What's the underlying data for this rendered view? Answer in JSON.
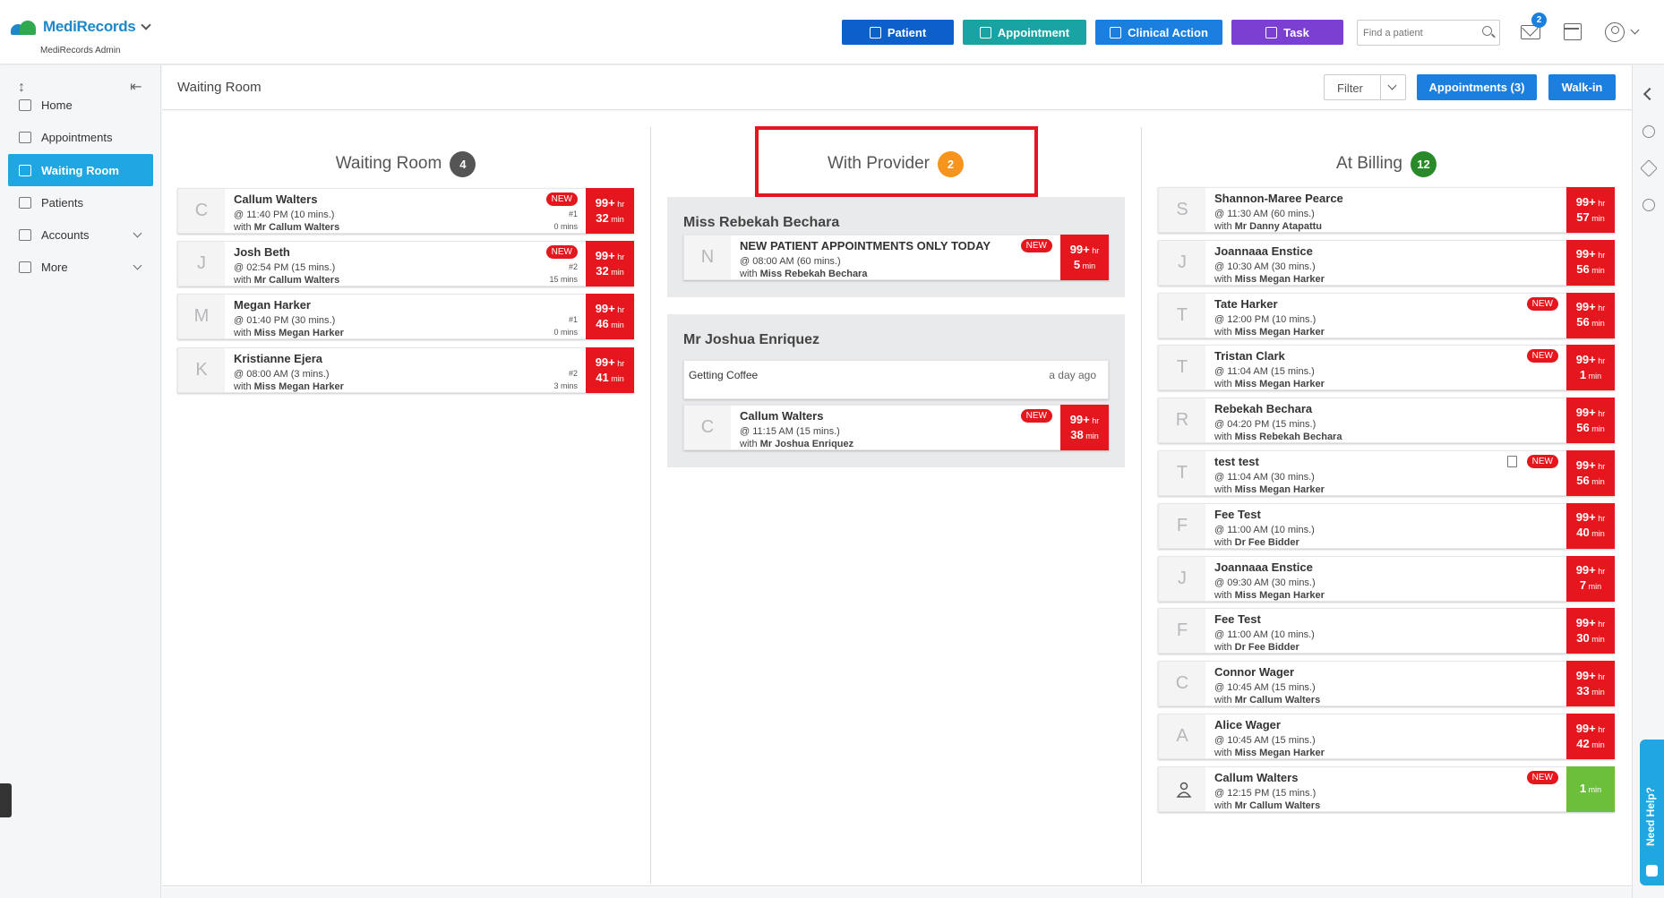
{
  "app": {
    "brand_primary": "Medi",
    "brand_secondary": "Records",
    "brand_sub": "MediRecords Admin",
    "search_placeholder": "Find a patient",
    "mail_count": "2"
  },
  "toolbar": {
    "patient": "Patient",
    "appointment": "Appointment",
    "clinical_action": "Clinical Action",
    "task": "Task"
  },
  "sidebar": {
    "items": [
      {
        "label": "Home",
        "icon": "home-icon"
      },
      {
        "label": "Appointments",
        "icon": "calendar-icon"
      },
      {
        "label": "Waiting Room",
        "icon": "people-icon",
        "active": true
      },
      {
        "label": "Patients",
        "icon": "person-icon"
      },
      {
        "label": "Accounts",
        "icon": "folder-icon"
      },
      {
        "label": "More",
        "icon": "folder-icon"
      }
    ]
  },
  "subheader": {
    "title": "Waiting Room",
    "filter": "Filter",
    "appointments": "Appointments (3)",
    "walkin": "Walk-in"
  },
  "help": "Need Help?",
  "colors": {
    "red": "#e5161d",
    "green_timer": "#6cbf3a",
    "active_nav": "#1ea7e1",
    "badge_grey": "#555555",
    "badge_orange": "#f7941d",
    "badge_green": "#2a8a2a"
  },
  "waiting": {
    "title": "Waiting Room",
    "count": "4",
    "cards": [
      {
        "letter": "C",
        "name": "Callum Walters",
        "time": "@ 11:40 PM (10 mins.)",
        "with_prefix": "with ",
        "with": "Mr Callum Walters",
        "new": "NEW",
        "num": "#1",
        "mins": "0 mins",
        "timer_big": "99+",
        "timer_unit": " hr",
        "timer_big2": "32",
        "timer_unit2": " min"
      },
      {
        "letter": "J",
        "name": "Josh Beth",
        "time": "@ 02:54 PM (15 mins.)",
        "with_prefix": "with ",
        "with": "Mr Callum Walters",
        "new": "NEW",
        "num": "#2",
        "mins": "15 mins",
        "timer_big": "99+",
        "timer_unit": " hr",
        "timer_big2": "32",
        "timer_unit2": " min"
      },
      {
        "letter": "M",
        "name": "Megan Harker",
        "time": "@ 01:40 PM (30 mins.)",
        "with_prefix": "with ",
        "with": "Miss Megan Harker",
        "new": "",
        "num": "#1",
        "mins": "0 mins",
        "timer_big": "99+",
        "timer_unit": " hr",
        "timer_big2": "46",
        "timer_unit2": " min"
      },
      {
        "letter": "K",
        "name": "Kristianne Ejera",
        "time": "@ 08:00 AM (3 mins.)",
        "with_prefix": "with ",
        "with": "Miss Megan Harker",
        "new": "",
        "num": "#2",
        "mins": "3 mins",
        "timer_big": "99+",
        "timer_unit": " hr",
        "timer_big2": "41",
        "timer_unit2": " min"
      }
    ]
  },
  "provider": {
    "title": "With Provider",
    "count": "2",
    "groups": [
      {
        "name": "Miss Rebekah Bechara",
        "card": {
          "letter": "N",
          "name": "NEW PATIENT APPOINTMENTS ONLY TODAY",
          "time": "@ 08:00 AM (60 mins.)",
          "with_prefix": "with ",
          "with": "Miss Rebekah Bechara",
          "new": "NEW",
          "timer_big": "99+",
          "timer_unit": " hr",
          "timer_big2": "5",
          "timer_unit2": " min"
        }
      },
      {
        "name": "Mr Joshua Enriquez",
        "note": {
          "text": "Getting Coffee",
          "ago": "a day ago"
        },
        "card": {
          "letter": "C",
          "name": "Callum Walters",
          "time": "@ 11:15 AM (15 mins.)",
          "with_prefix": "with ",
          "with": "Mr Joshua Enriquez",
          "new": "NEW",
          "timer_big": "99+",
          "timer_unit": " hr",
          "timer_big2": "38",
          "timer_unit2": " min"
        }
      }
    ]
  },
  "billing": {
    "title": "At Billing",
    "count": "12",
    "cards": [
      {
        "letter": "S",
        "name": "Shannon-Maree Pearce",
        "time": "@ 11:30 AM (60 mins.)",
        "with_prefix": "with ",
        "with": "Mr Danny Atapattu",
        "new": "",
        "timer_big": "99+",
        "timer_unit": " hr",
        "timer_big2": "57",
        "timer_unit2": " min"
      },
      {
        "letter": "J",
        "name": "Joannaaa Enstice",
        "time": "@ 10:30 AM (30 mins.)",
        "with_prefix": "with ",
        "with": "Miss Megan Harker",
        "new": "",
        "timer_big": "99+",
        "timer_unit": " hr",
        "timer_big2": "56",
        "timer_unit2": " min"
      },
      {
        "letter": "T",
        "name": "Tate Harker",
        "time": "@ 12:00 PM (10 mins.)",
        "with_prefix": "with ",
        "with": "Miss Megan Harker",
        "new": "NEW",
        "timer_big": "99+",
        "timer_unit": " hr",
        "timer_big2": "56",
        "timer_unit2": " min"
      },
      {
        "letter": "T",
        "name": "Tristan Clark",
        "time": "@ 11:04 AM (15 mins.)",
        "with_prefix": "with ",
        "with": "Miss Megan Harker",
        "new": "NEW",
        "timer_big": "99+",
        "timer_unit": " hr",
        "timer_big2": "1",
        "timer_unit2": " min"
      },
      {
        "letter": "R",
        "name": "Rebekah Bechara",
        "time": "@ 04:20 PM (15 mins.)",
        "with_prefix": "with ",
        "with": "Miss Rebekah Bechara",
        "new": "",
        "timer_big": "99+",
        "timer_unit": " hr",
        "timer_big2": "56",
        "timer_unit2": " min"
      },
      {
        "letter": "T",
        "name": "test test",
        "time": "@ 11:04 AM (30 mins.)",
        "with_prefix": "with ",
        "with": "Miss Megan Harker",
        "new": "NEW",
        "doc": true,
        "timer_big": "99+",
        "timer_unit": " hr",
        "timer_big2": "56",
        "timer_unit2": " min"
      },
      {
        "letter": "F",
        "name": "Fee Test",
        "time": "@ 11:00 AM (10 mins.)",
        "with_prefix": "with ",
        "with": "Dr Fee Bidder",
        "new": "",
        "timer_big": "99+",
        "timer_unit": " hr",
        "timer_big2": "40",
        "timer_unit2": " min"
      },
      {
        "letter": "J",
        "name": "Joannaaa Enstice",
        "time": "@ 09:30 AM (30 mins.)",
        "with_prefix": "with ",
        "with": "Miss Megan Harker",
        "new": "",
        "timer_big": "99+",
        "timer_unit": " hr",
        "timer_big2": "7",
        "timer_unit2": " min"
      },
      {
        "letter": "F",
        "name": "Fee Test",
        "time": "@ 11:00 AM (10 mins.)",
        "with_prefix": "with ",
        "with": "Dr Fee Bidder",
        "new": "",
        "timer_big": "99+",
        "timer_unit": " hr",
        "timer_big2": "30",
        "timer_unit2": " min"
      },
      {
        "letter": "C",
        "name": "Connor Wager",
        "time": "@ 10:45 AM (15 mins.)",
        "with_prefix": "with ",
        "with": "Mr Callum Walters",
        "new": "",
        "timer_big": "99+",
        "timer_unit": " hr",
        "timer_big2": "33",
        "timer_unit2": " min"
      },
      {
        "letter": "A",
        "name": "Alice Wager",
        "time": "@ 10:45 AM (15 mins.)",
        "with_prefix": "with ",
        "with": "Miss Megan Harker",
        "new": "",
        "timer_big": "99+",
        "timer_unit": " hr",
        "timer_big2": "42",
        "timer_unit2": " min"
      },
      {
        "letter": "",
        "icon": "person-icon",
        "name": "Callum Walters",
        "time": "@ 12:15 PM (15 mins.)",
        "with_prefix": "with ",
        "with": "Mr Callum Walters",
        "new": "NEW",
        "green": true,
        "timer_big": "",
        "timer_unit": "",
        "timer_big2": "1",
        "timer_unit2": " min"
      }
    ]
  }
}
